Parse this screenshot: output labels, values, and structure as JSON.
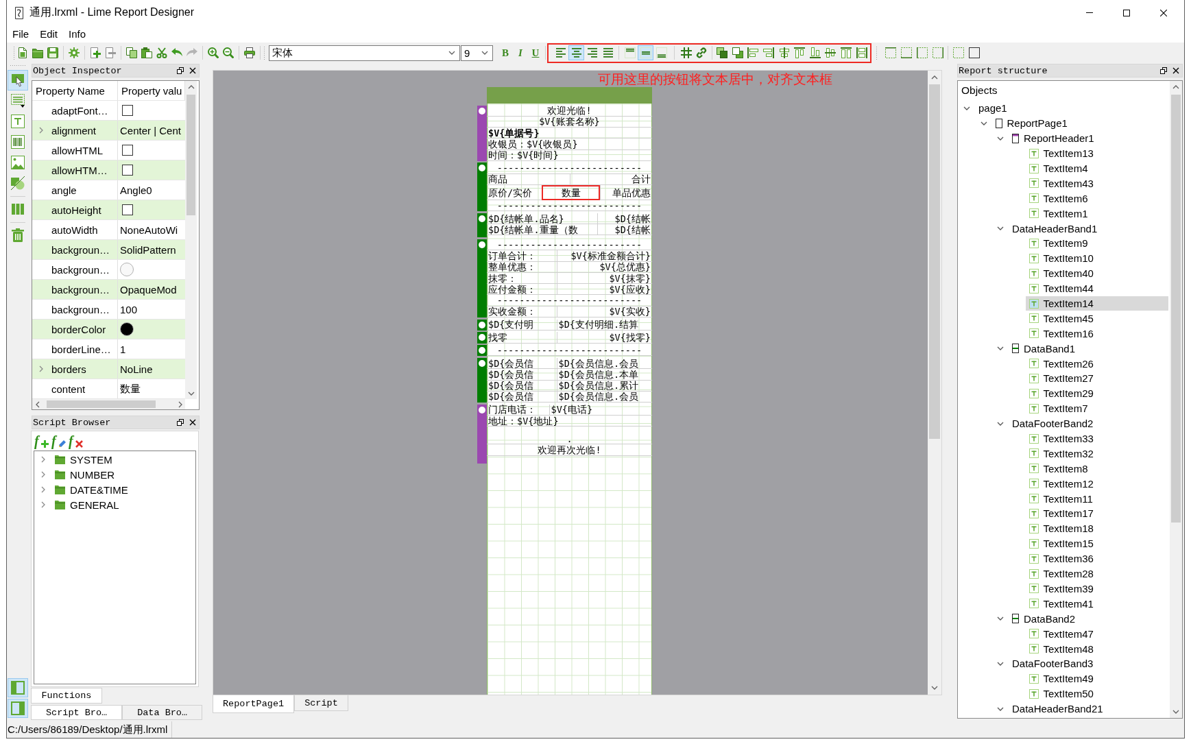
{
  "window": {
    "title": "通用.lrxml - Lime Report Designer"
  },
  "menu": [
    "File",
    "Edit",
    "Info"
  ],
  "toolbar": {
    "font": "宋体",
    "font_size": "9",
    "style_buttons": [
      "B",
      "I",
      "U"
    ],
    "text_align": [
      {
        "kind": "left",
        "selected": false
      },
      {
        "kind": "center",
        "selected": true
      },
      {
        "kind": "right",
        "selected": false
      },
      {
        "kind": "justify",
        "selected": false
      }
    ],
    "vertical_align": [
      {
        "kind": "top",
        "selected": false
      },
      {
        "kind": "middle",
        "selected": true
      },
      {
        "kind": "bottom",
        "selected": false
      }
    ]
  },
  "annotation": "可用这里的按钮将文本居中，对齐文本框",
  "tools": [
    [
      {
        "kind": "select",
        "selected": true
      },
      {
        "kind": "band",
        "selected": false
      },
      {
        "kind": "text",
        "selected": false
      },
      {
        "kind": "barcode",
        "selected": false
      },
      {
        "kind": "image",
        "selected": false
      },
      {
        "kind": "shape",
        "selected": false
      }
    ],
    [
      {
        "kind": "columns",
        "selected": false
      }
    ],
    [
      {
        "kind": "delete",
        "selected": false
      }
    ]
  ],
  "dock_toggles": [
    {
      "kind": "left",
      "on": true
    },
    {
      "kind": "right",
      "on": true
    }
  ],
  "object_inspector": {
    "title": "Object Inspector",
    "columns": [
      "Property Name",
      "Property valu"
    ],
    "rows": [
      {
        "name": "adaptFont…",
        "kind": "checkbox",
        "checked": false
      },
      {
        "name": "alignment",
        "expanded": false,
        "kind": "text",
        "value": "Center | Cent"
      },
      {
        "name": "allowHTML",
        "kind": "checkbox",
        "checked": false
      },
      {
        "name": "allowHTM…",
        "kind": "checkbox",
        "checked": false
      },
      {
        "name": "angle",
        "kind": "text",
        "value": "Angle0"
      },
      {
        "name": "autoHeight",
        "kind": "checkbox",
        "checked": false
      },
      {
        "name": "autoWidth",
        "kind": "text",
        "value": "NoneAutoWi"
      },
      {
        "name": "backgroun…",
        "kind": "text",
        "value": "SolidPattern"
      },
      {
        "name": "backgroun…",
        "kind": "color",
        "color": "#f8f8f8"
      },
      {
        "name": "backgroun…",
        "kind": "text",
        "value": "OpaqueMod"
      },
      {
        "name": "backgroun…",
        "kind": "text",
        "value": "100"
      },
      {
        "name": "borderColor",
        "kind": "color",
        "color": "#000000"
      },
      {
        "name": "borderLine…",
        "kind": "text",
        "value": "1"
      },
      {
        "name": "borders",
        "expanded": false,
        "kind": "text",
        "value": "NoLine"
      },
      {
        "name": "content",
        "kind": "text",
        "value": "数量"
      }
    ]
  },
  "script_browser": {
    "title": "Script Browser",
    "function_buttons": [
      {
        "kind": "add",
        "glyph": "f"
      },
      {
        "kind": "edit",
        "glyph": "f"
      },
      {
        "kind": "delete",
        "glyph": "f"
      }
    ],
    "groups": [
      {
        "label": "SYSTEM",
        "expanded": false
      },
      {
        "label": "NUMBER",
        "expanded": false
      },
      {
        "label": "DATE&TIME",
        "expanded": false
      },
      {
        "label": "GENERAL",
        "expanded": false
      }
    ],
    "tabs": [
      {
        "label": "Functions",
        "selected": true
      }
    ]
  },
  "dock_tabs": [
    {
      "label": "Script Bro…",
      "selected": true
    },
    {
      "label": "Data Bro…",
      "selected": false
    }
  ],
  "report_page": {
    "bands": [
      {
        "kind": "header",
        "lines": [
          {
            "items": [
              {
                "text": "欢迎光临!",
                "kind": "center"
              }
            ]
          },
          {
            "items": [
              {
                "text": "$V{账套名称}",
                "kind": "center"
              }
            ]
          },
          {
            "items": [
              {
                "text": "$V{单据号}",
                "kind": "left",
                "bold": true
              }
            ]
          },
          {
            "items": [
              {
                "text": "收银员：$V{收银员}",
                "kind": "left"
              }
            ]
          },
          {
            "items": [
              {
                "text": "时间：$V{时间}",
                "kind": "left"
              }
            ]
          }
        ]
      },
      {
        "kind": "column-header",
        "lines": [
          {
            "items": [
              {
                "text": "--------------------------",
                "kind": "center"
              }
            ]
          },
          {
            "items": [
              {
                "text": "商品",
                "kind": "left"
              },
              {
                "text": "合计",
                "kind": "right"
              }
            ]
          },
          {
            "items": [
              {
                "text": "原价/实价",
                "kind": "left"
              },
              {
                "text": "数量",
                "kind": "center",
                "highlighted": true
              },
              {
                "text": "单品优惠",
                "kind": "right"
              }
            ]
          },
          {
            "items": [
              {
                "text": "--------------------------",
                "kind": "center"
              }
            ]
          }
        ]
      },
      {
        "kind": "detail",
        "lines": [
          {
            "items": [
              {
                "text": "$D{结帐单.品名}",
                "kind": "left"
              },
              {
                "text": "$D{结帐",
                "kind": "right"
              }
            ]
          },
          {
            "items": [
              {
                "text": "$D{结帐单.重量（数",
                "kind": "left"
              },
              {
                "text": "$D{结帐",
                "kind": "right"
              }
            ]
          }
        ]
      },
      {
        "kind": "summary",
        "lines": [
          {
            "items": [
              {
                "text": "--------------------------",
                "kind": "center"
              }
            ]
          },
          {
            "items": [
              {
                "text": "订单合计：",
                "kind": "left"
              },
              {
                "text": "$V{标准金额合计}",
                "kind": "right"
              }
            ]
          },
          {
            "items": [
              {
                "text": "整单优惠：",
                "kind": "left"
              },
              {
                "text": "$V{总优惠}",
                "kind": "right"
              }
            ]
          },
          {
            "items": [
              {
                "text": "抹零：",
                "kind": "left"
              },
              {
                "text": "$V{抹零}",
                "kind": "right"
              }
            ]
          },
          {
            "items": [
              {
                "text": "应付金额：",
                "kind": "left"
              },
              {
                "text": "$V{应收}",
                "kind": "right"
              }
            ]
          },
          {
            "items": [
              {
                "text": "--------------------------",
                "kind": "center"
              }
            ]
          },
          {
            "items": [
              {
                "text": "实收金额：",
                "kind": "left"
              },
              {
                "text": "$V{实收}",
                "kind": "right"
              }
            ]
          }
        ]
      },
      {
        "kind": "summary",
        "lines": [
          {
            "items": [
              {
                "text": "$D{支付明",
                "kind": "left"
              },
              {
                "text": "$D{支付明细.结算",
                "kind": "left"
              }
            ]
          }
        ]
      },
      {
        "kind": "summary",
        "lines": [
          {
            "items": [
              {
                "text": "找零",
                "kind": "left"
              },
              {
                "text": "$V{找零}",
                "kind": "right"
              }
            ]
          }
        ]
      },
      {
        "kind": "summary",
        "lines": [
          {
            "items": [
              {
                "text": "--------------------------",
                "kind": "center"
              }
            ]
          }
        ]
      },
      {
        "kind": "summary",
        "lines": [
          {
            "items": [
              {
                "text": "$D{会员信",
                "kind": "left"
              },
              {
                "text": "$D{会员信息.会员",
                "kind": "left"
              }
            ]
          },
          {
            "items": [
              {
                "text": "$D{会员信",
                "kind": "left"
              },
              {
                "text": "$D{会员信息.本单",
                "kind": "left"
              }
            ]
          },
          {
            "items": [
              {
                "text": "$D{会员信",
                "kind": "left"
              },
              {
                "text": "$D{会员信息.累计",
                "kind": "left"
              }
            ]
          },
          {
            "items": [
              {
                "text": "$D{会员信",
                "kind": "left"
              },
              {
                "text": "$D{会员信息.会员",
                "kind": "left"
              }
            ]
          }
        ]
      },
      {
        "kind": "footer",
        "lines": [
          {
            "items": [
              {
                "text": "门店电话：",
                "kind": "left"
              },
              {
                "text": "$V{电话}",
                "kind": "left"
              }
            ]
          },
          {
            "items": [
              {
                "text": "地址：$V{地址}",
                "kind": "left"
              }
            ]
          },
          {
            "items": [
              {
                "text": ".",
                "kind": "center"
              }
            ]
          },
          {
            "items": [
              {
                "text": "欢迎再次光临!",
                "kind": "center"
              }
            ]
          }
        ]
      }
    ]
  },
  "page_tabs": [
    {
      "label": "ReportPage1",
      "selected": true
    },
    {
      "label": "Script",
      "selected": false
    }
  ],
  "report_structure": {
    "title": "Report structure",
    "header": "Objects",
    "tree": [
      {
        "label": "page1",
        "kind": "object",
        "expanded": true,
        "selected": false,
        "children": [
          {
            "label": "ReportPage1",
            "kind": "page",
            "expanded": true,
            "selected": false,
            "children": [
              {
                "label": "ReportHeader1",
                "kind": "header-band",
                "expanded": true,
                "selected": false,
                "children": [
                  {
                    "label": "TextItem13",
                    "kind": "text",
                    "selected": false
                  },
                  {
                    "label": "TextItem4",
                    "kind": "text",
                    "selected": false
                  },
                  {
                    "label": "TextItem43",
                    "kind": "text",
                    "selected": false
                  },
                  {
                    "label": "TextItem6",
                    "kind": "text",
                    "selected": false
                  },
                  {
                    "label": "TextItem1",
                    "kind": "text",
                    "selected": false
                  }
                ]
              },
              {
                "label": "DataHeaderBand1",
                "kind": "object",
                "expanded": true,
                "selected": false,
                "children": [
                  {
                    "label": "TextItem9",
                    "kind": "text",
                    "selected": false
                  },
                  {
                    "label": "TextItem10",
                    "kind": "text",
                    "selected": false
                  },
                  {
                    "label": "TextItem40",
                    "kind": "text",
                    "selected": false
                  },
                  {
                    "label": "TextItem44",
                    "kind": "text",
                    "selected": false
                  },
                  {
                    "label": "TextItem14",
                    "kind": "text",
                    "selected": true
                  },
                  {
                    "label": "TextItem45",
                    "kind": "text",
                    "selected": false
                  },
                  {
                    "label": "TextItem16",
                    "kind": "text",
                    "selected": false
                  }
                ]
              },
              {
                "label": "DataBand1",
                "kind": "data-band",
                "expanded": true,
                "selected": false,
                "children": [
                  {
                    "label": "TextItem26",
                    "kind": "text",
                    "selected": false
                  },
                  {
                    "label": "TextItem27",
                    "kind": "text",
                    "selected": false
                  },
                  {
                    "label": "TextItem29",
                    "kind": "text",
                    "selected": false
                  },
                  {
                    "label": "TextItem7",
                    "kind": "text",
                    "selected": false
                  }
                ]
              },
              {
                "label": "DataFooterBand2",
                "kind": "object",
                "expanded": true,
                "selected": false,
                "children": [
                  {
                    "label": "TextItem33",
                    "kind": "text",
                    "selected": false
                  },
                  {
                    "label": "TextItem32",
                    "kind": "text",
                    "selected": false
                  },
                  {
                    "label": "TextItem8",
                    "kind": "text",
                    "selected": false
                  },
                  {
                    "label": "TextItem12",
                    "kind": "text",
                    "selected": false
                  },
                  {
                    "label": "TextItem11",
                    "kind": "text",
                    "selected": false
                  },
                  {
                    "label": "TextItem17",
                    "kind": "text",
                    "selected": false
                  },
                  {
                    "label": "TextItem18",
                    "kind": "text",
                    "selected": false
                  },
                  {
                    "label": "TextItem15",
                    "kind": "text",
                    "selected": false
                  },
                  {
                    "label": "TextItem36",
                    "kind": "text",
                    "selected": false
                  },
                  {
                    "label": "TextItem28",
                    "kind": "text",
                    "selected": false
                  },
                  {
                    "label": "TextItem39",
                    "kind": "text",
                    "selected": false
                  },
                  {
                    "label": "TextItem41",
                    "kind": "text",
                    "selected": false
                  }
                ]
              },
              {
                "label": "DataBand2",
                "kind": "data-band",
                "expanded": true,
                "selected": false,
                "children": [
                  {
                    "label": "TextItem47",
                    "kind": "text",
                    "selected": false
                  },
                  {
                    "label": "TextItem48",
                    "kind": "text",
                    "selected": false
                  }
                ]
              },
              {
                "label": "DataFooterBand3",
                "kind": "object",
                "expanded": true,
                "selected": false,
                "children": [
                  {
                    "label": "TextItem49",
                    "kind": "text",
                    "selected": false
                  },
                  {
                    "label": "TextItem50",
                    "kind": "text",
                    "selected": false
                  }
                ]
              },
              {
                "label": "DataHeaderBand21",
                "kind": "object",
                "expanded": true,
                "selected": false
              }
            ]
          }
        ]
      }
    ]
  },
  "status_bar": "C:/Users/86189/Desktop/通用.lrxml"
}
